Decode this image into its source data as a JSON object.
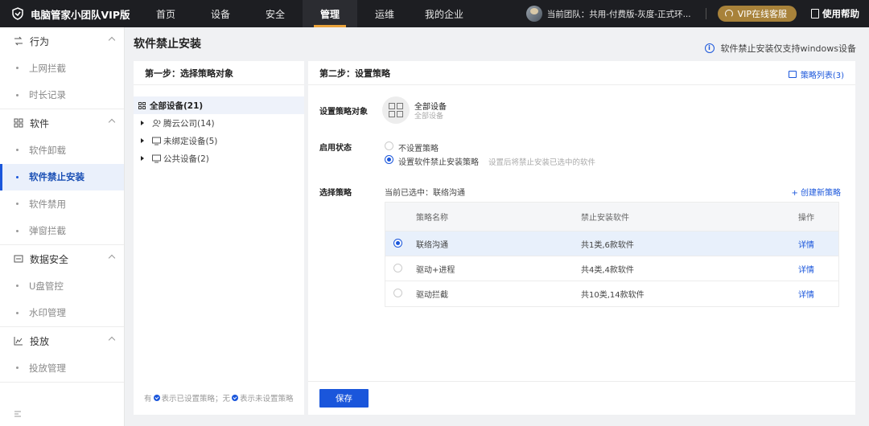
{
  "app": {
    "title": "电脑管家小团队VIP版"
  },
  "nav": [
    {
      "label": "首页",
      "active": false
    },
    {
      "label": "设备",
      "active": false
    },
    {
      "label": "安全",
      "active": false
    },
    {
      "label": "管理",
      "active": true
    },
    {
      "label": "运维",
      "active": false
    },
    {
      "label": "我的企业",
      "active": false
    }
  ],
  "top_right": {
    "team": "当前团队：共用-付费版-灰度-正式环...",
    "vip_label": "VIP在线客服",
    "help_label": "使用帮助"
  },
  "sidebar": {
    "groups": [
      {
        "label": "行为",
        "icon": "behavior-icon",
        "items": [
          "上网拦截",
          "时长记录"
        ]
      },
      {
        "label": "软件",
        "icon": "software-grid-icon",
        "items": [
          "软件卸载",
          "软件禁止安装",
          "软件禁用",
          "弹窗拦截"
        ]
      },
      {
        "label": "数据安全",
        "icon": "data-security-icon",
        "items": [
          "U盘管控",
          "水印管理"
        ]
      },
      {
        "label": "投放",
        "icon": "deploy-chart-icon",
        "items": [
          "投放管理"
        ]
      }
    ],
    "active_item": "软件禁止安装"
  },
  "page": {
    "title": "软件禁止安装",
    "notice": "软件禁止安装仅支持windows设备"
  },
  "step1": {
    "title": "第一步：选择策略对象",
    "root": "全部设备(21)",
    "nodes": [
      {
        "label": "腾云公司(14)",
        "icon": "user-group-icon"
      },
      {
        "label": "未绑定设备(5)",
        "icon": "monitor-icon"
      },
      {
        "label": "公共设备(2)",
        "icon": "monitor-icon"
      }
    ],
    "legend": {
      "part1": "有",
      "part2": "表示已设置策略；无",
      "part3": "表示未设置策略"
    }
  },
  "step2": {
    "title": "第二步：设置策略",
    "policy_list_label": "策略列表(3)",
    "target_label": "设置策略对象",
    "target_name": "全部设备",
    "target_sub": "全部设备",
    "status_label": "启用状态",
    "options": [
      {
        "label": "不设置策略",
        "checked": false
      },
      {
        "label": "设置软件禁止安装策略",
        "checked": true
      }
    ],
    "option_hint": "设置后将禁止安装已选中的软件",
    "select_label": "选择策略",
    "current": "当前已选中：联络沟通",
    "create_label": "+ 创建新策略",
    "table": {
      "headers": [
        "策略名称",
        "禁止安装软件",
        "操作"
      ],
      "rows": [
        {
          "name": "联络沟通",
          "software": "共1类,6款软件",
          "action": "详情",
          "selected": true
        },
        {
          "name": "驱动+进程",
          "software": "共4类,4款软件",
          "action": "详情",
          "selected": false
        },
        {
          "name": "驱动拦截",
          "software": "共10类,14款软件",
          "action": "详情",
          "selected": false
        }
      ]
    },
    "save_label": "保存"
  },
  "colors": {
    "primary": "#1a56db",
    "topbar": "#1d1e22",
    "vip": "#a8823a",
    "active_underline": "#e9a23b"
  }
}
